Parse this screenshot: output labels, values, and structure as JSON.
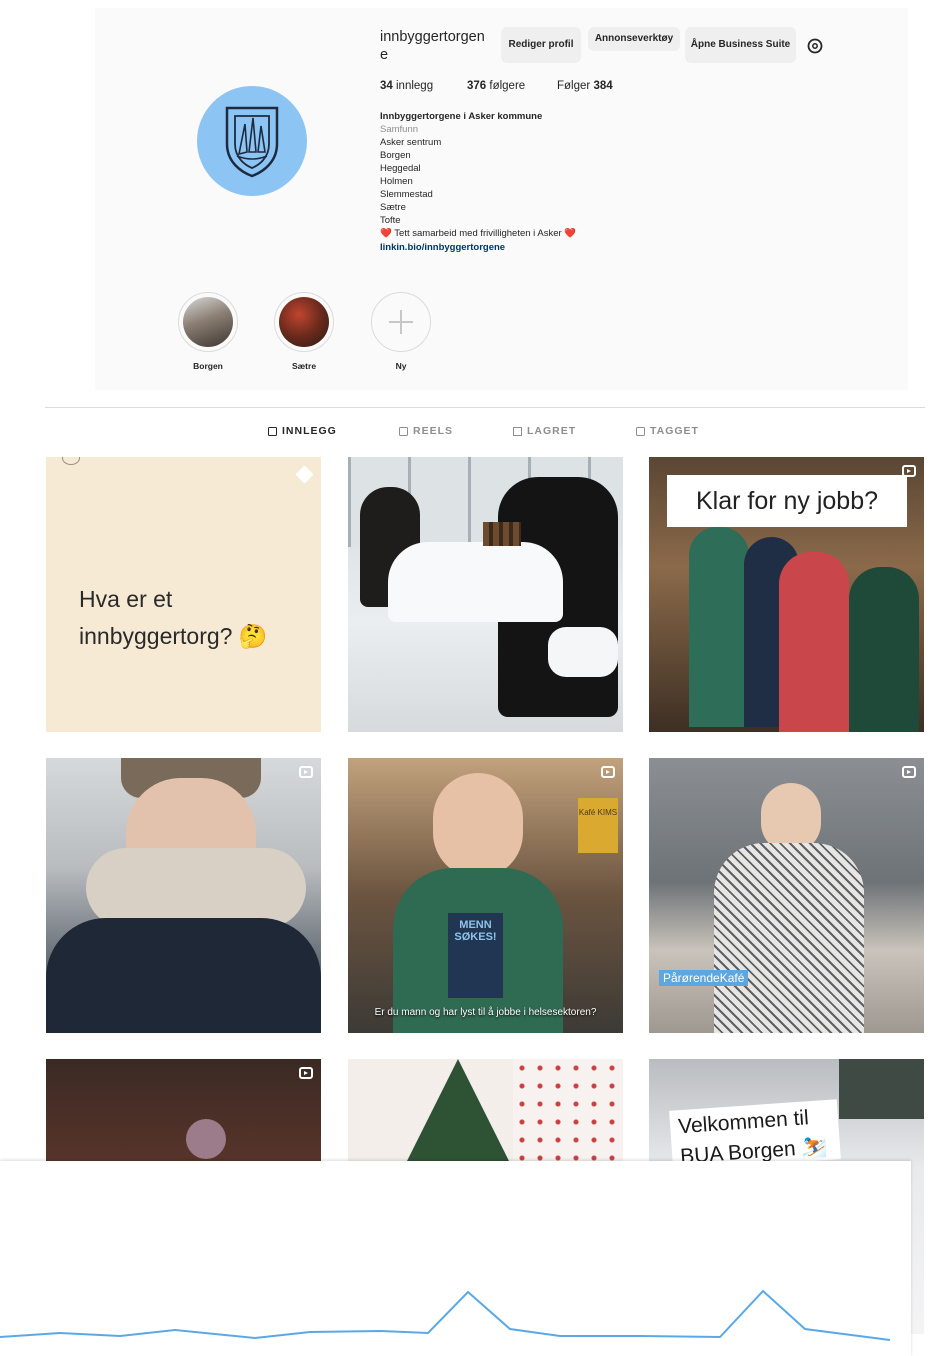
{
  "profile": {
    "username": "innbyggertorgene",
    "edit_button": "Rediger profil",
    "ads_button": "Annonseverktøy",
    "business_button": "Åpne Business Suite",
    "stats": {
      "posts_count": "34",
      "posts_label": "innlegg",
      "followers_count": "376",
      "followers_label": "følgere",
      "following_label": "Følger",
      "following_count": "384"
    },
    "bio": {
      "name": "Innbyggertorgene i Asker kommune",
      "category": "Samfunn",
      "lines": [
        "Asker sentrum",
        "Borgen",
        "Heggedal",
        "Holmen",
        "Slemmestad",
        "Sætre",
        "Tofte"
      ],
      "tagline": "❤️ Tett samarbeid med frivilligheten i Asker ❤️",
      "link": "linkin.bio/innbyggertorgene"
    }
  },
  "highlights": [
    {
      "label": "Borgen"
    },
    {
      "label": "Sætre"
    },
    {
      "label": "Ny"
    }
  ],
  "tabs": [
    {
      "label": "INNLEGG",
      "active": true
    },
    {
      "label": "REELS",
      "active": false
    },
    {
      "label": "LAGRET",
      "active": false
    },
    {
      "label": "TAGGET",
      "active": false
    }
  ],
  "posts": [
    {
      "caption_line1": "Hva er et",
      "caption_line2": "innbyggertorg? 🤔",
      "pinned": true
    },
    {
      "caption": ""
    },
    {
      "caption": "Klar for ny jobb?"
    },
    {
      "caption": ""
    },
    {
      "caption": "Er du mann og har lyst til å jobbe i helsesektoren?",
      "book_text": "MENN SØKES!",
      "sign_text": "Kafé KIMS"
    },
    {
      "caption": "PårørendeKafé"
    },
    {
      "caption": ""
    },
    {
      "caption": ""
    },
    {
      "caption": "Velkommen til BUA Borgen ⛷️"
    }
  ],
  "colors": {
    "avatar_bg": "#8cc5f3",
    "link": "#00376b",
    "line_chart": "#5aa9e6"
  },
  "icons": [
    "settings-icon",
    "shield-logo-icon",
    "plus-icon",
    "grid-icon",
    "reels-icon",
    "bookmark-icon",
    "tag-icon",
    "pin-icon",
    "reel-icon"
  ]
}
